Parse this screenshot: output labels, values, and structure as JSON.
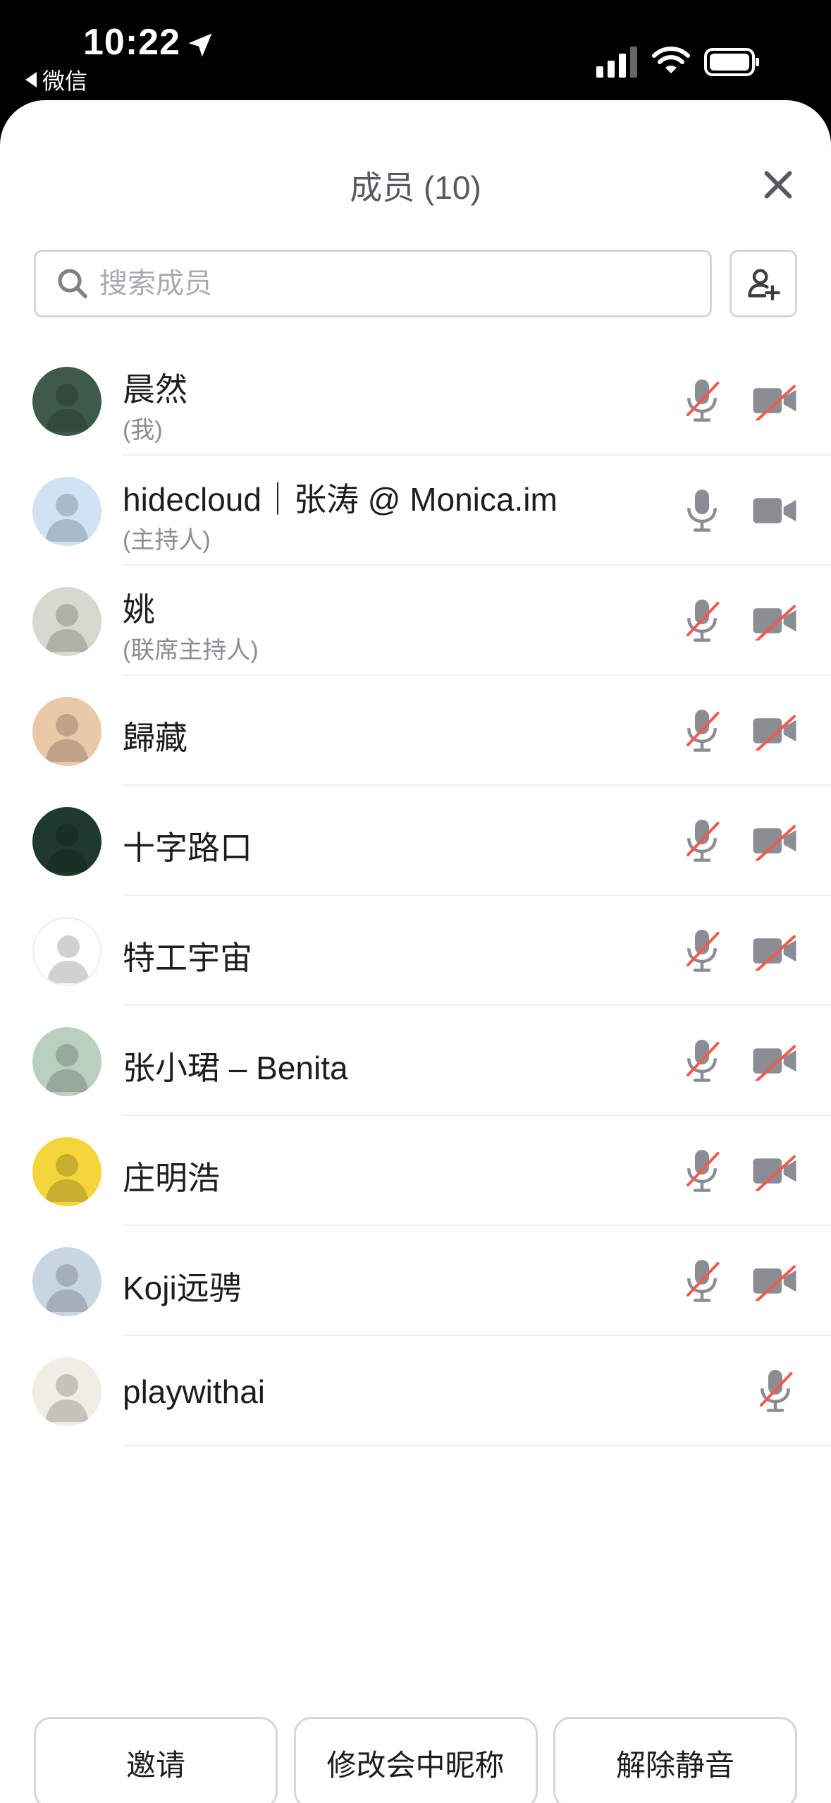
{
  "status_bar": {
    "time": "10:22",
    "back_app": "微信",
    "icons": [
      "location-arrow-icon",
      "cellular-signal-icon",
      "wifi-icon",
      "battery-icon"
    ]
  },
  "header": {
    "title": "成员 (10)",
    "close_icon": "close-icon"
  },
  "search": {
    "placeholder": "搜索成员",
    "value": ""
  },
  "add_member_icon": "add-person-icon",
  "members": [
    {
      "name": "晨然",
      "role": "(我)",
      "mic": "muted",
      "camera": "off",
      "avatar_color": "#3d5a4a"
    },
    {
      "name": "hidecloud｜张涛 @ Monica.im",
      "role": "(主持人)",
      "mic": "on",
      "camera": "on",
      "avatar_color": "#cfe3f5"
    },
    {
      "name": "姚",
      "role": "(联席主持人)",
      "mic": "muted",
      "camera": "off",
      "avatar_color": "#d8d8d0"
    },
    {
      "name": "歸藏",
      "role": "",
      "mic": "muted",
      "camera": "off",
      "avatar_color": "#e9c9a8"
    },
    {
      "name": "十字路口",
      "role": "",
      "mic": "muted",
      "camera": "off",
      "avatar_color": "#1f3a2c"
    },
    {
      "name": "特工宇宙",
      "role": "",
      "mic": "muted",
      "camera": "off",
      "avatar_color": "#ffffff"
    },
    {
      "name": "张小珺 – Benita",
      "role": "",
      "mic": "muted",
      "camera": "off",
      "avatar_color": "#b9cfc0"
    },
    {
      "name": "庄明浩",
      "role": "",
      "mic": "muted",
      "camera": "off",
      "avatar_color": "#f4d63a"
    },
    {
      "name": "Koji远骋",
      "role": "",
      "mic": "muted",
      "camera": "off",
      "avatar_color": "#c9d6e2"
    },
    {
      "name": "playwithai",
      "role": "",
      "mic": "muted",
      "camera": "none",
      "avatar_color": "#f2ede4"
    }
  ],
  "actions": {
    "invite": "邀请",
    "rename": "修改会中昵称",
    "unmute": "解除静音"
  },
  "colors": {
    "icon_gray": "#8a8e94",
    "muted_red": "#f05a4f",
    "text": "#1c1d20",
    "border": "#d4d6da"
  }
}
